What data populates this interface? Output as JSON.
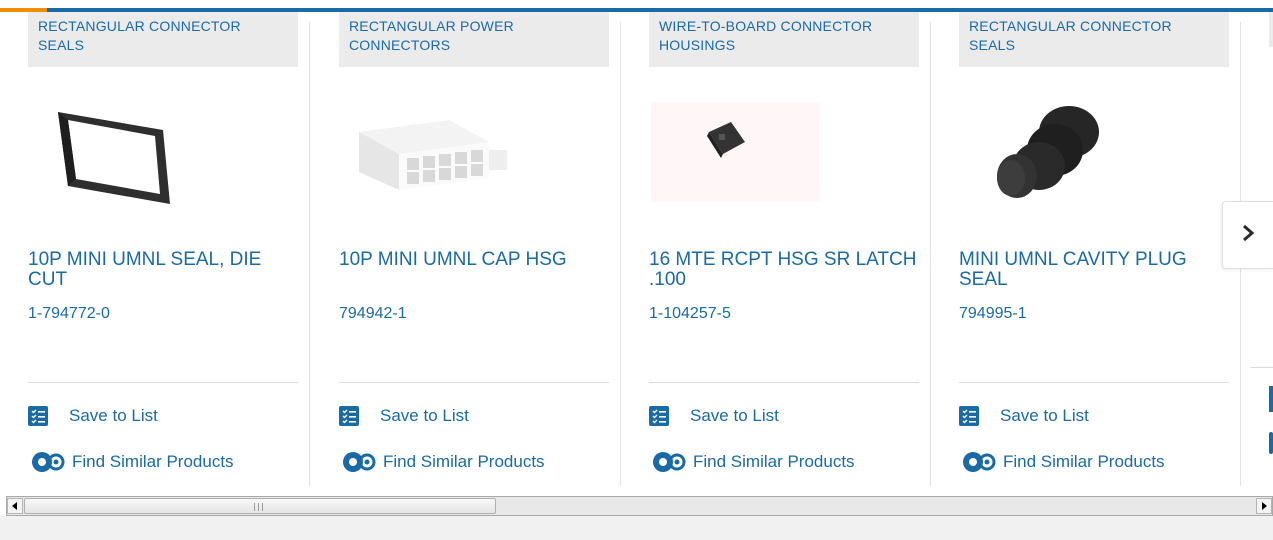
{
  "colors": {
    "accent": "#1a6aa6",
    "brand_orange": "#f28d00",
    "category_bg": "#ebebeb"
  },
  "products": [
    {
      "category": "RECTANGULAR CONNECTOR SEALS",
      "name": "10P MINI UMNL SEAL, DIE CUT",
      "part_number": "1-794772-0",
      "save_label": "Save to List",
      "find_label": "Find Similar Products",
      "image": "rectangular-seal-image"
    },
    {
      "category": "RECTANGULAR POWER CONNECTORS",
      "name": "10P MINI UMNL CAP HSG",
      "part_number": "794942-1",
      "save_label": "Save to List",
      "find_label": "Find Similar Products",
      "image": "power-connector-image"
    },
    {
      "category": "WIRE-TO-BOARD CONNECTOR HOUSINGS",
      "name": "16 MTE RCPT HSG SR LATCH .100",
      "part_number": "1-104257-5",
      "save_label": "Save to List",
      "find_label": "Find Similar Products",
      "image": "housing-image"
    },
    {
      "category": "RECTANGULAR CONNECTOR SEALS",
      "name": "MINI UMNL CAVITY PLUG SEAL",
      "part_number": "794995-1",
      "save_label": "Save to List",
      "find_label": "Find Similar Products",
      "image": "cavity-plug-image"
    }
  ],
  "carousel": {
    "next_icon": "chevron-right-icon"
  },
  "scrollbar": {
    "left_icon": "arrow-left-icon",
    "right_icon": "arrow-right-icon"
  }
}
